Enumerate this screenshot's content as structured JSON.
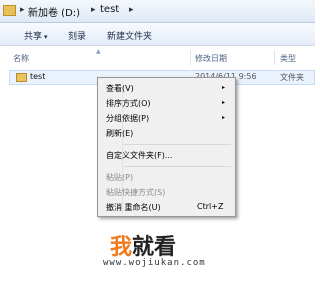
{
  "address_bar": {
    "path": [
      "新加卷 (D:)",
      "test"
    ],
    "separator": "▸"
  },
  "toolbar": {
    "share": "共享",
    "share_caret": "▾",
    "burn": "刻录",
    "new_folder": "新建文件夹"
  },
  "columns": {
    "name": "名称",
    "modified": "修改日期",
    "type": "类型"
  },
  "files": [
    {
      "name": "test",
      "modified": "2014/6/11 9:56",
      "type": "文件夹"
    }
  ],
  "context_menu": {
    "items": [
      {
        "label": "查看(V)",
        "arrow": "▸"
      },
      {
        "label": "排序方式(O)",
        "arrow": "▸"
      },
      {
        "label": "分组依据(P)",
        "arrow": "▸"
      },
      {
        "label": "刷新(E)"
      },
      {
        "label": "自定义文件夹(F)..."
      },
      {
        "label": "粘贴(P)",
        "disabled": true
      },
      {
        "label": "粘贴快捷方式(S)",
        "disabled": true
      },
      {
        "label": "撤消 重命名(U)",
        "shortcut": "Ctrl+Z"
      }
    ]
  },
  "watermark": {
    "logo_part1": "我",
    "logo_part2": "就看",
    "url": "www.wojiukan.com"
  },
  "colors": {
    "accent": "#f07a1a",
    "selection": "#e9f2fd",
    "menu_bg": "#f0f0f0"
  }
}
